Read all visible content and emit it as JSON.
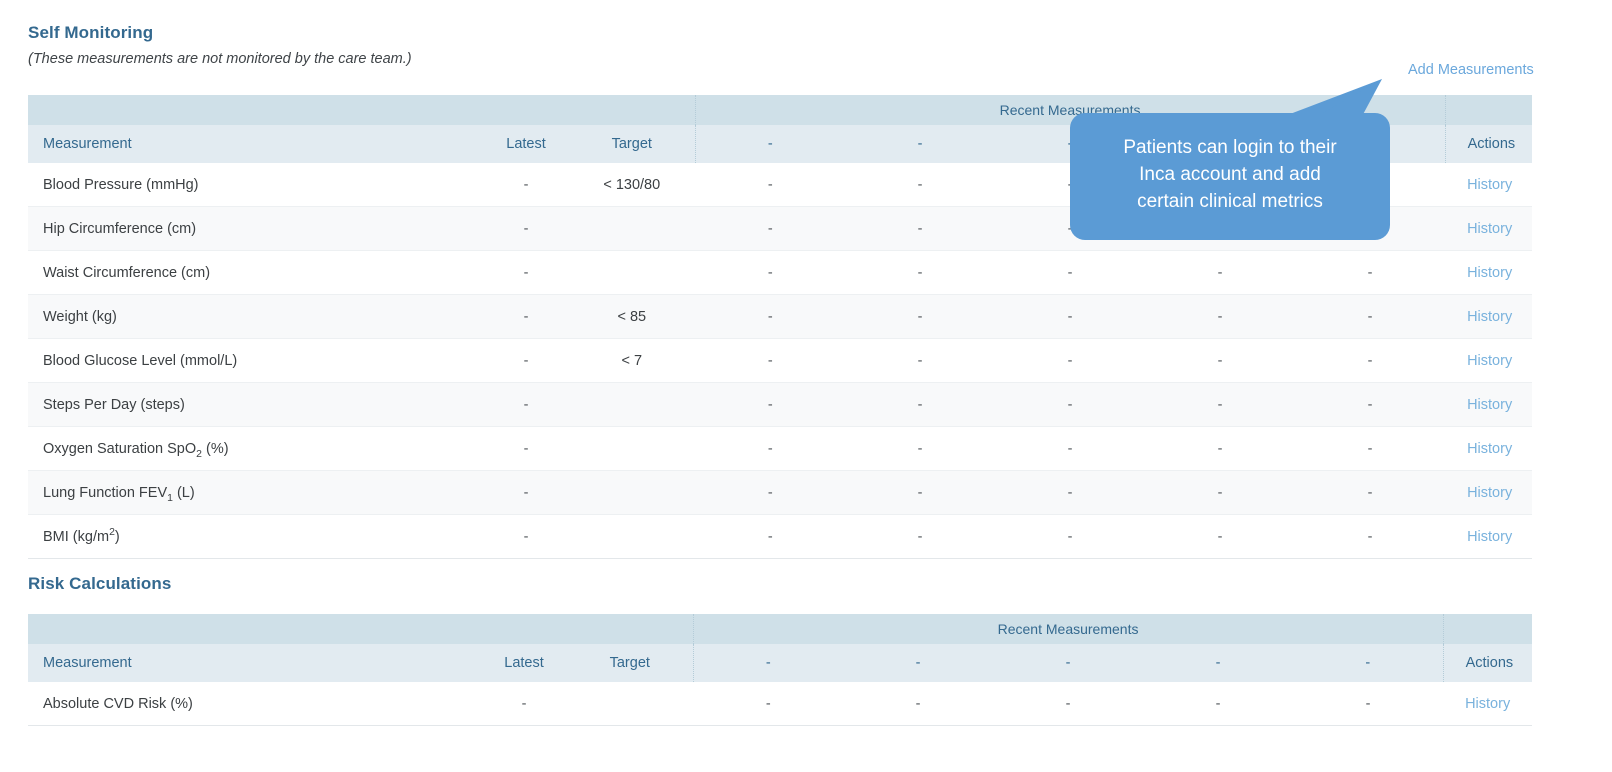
{
  "self_monitoring": {
    "title": "Self Monitoring",
    "subtitle": "(These measurements are not monitored by the care team.)",
    "add_link": "Add Measurements",
    "group_header": "Recent Measurements",
    "columns": {
      "measurement": "Measurement",
      "latest": "Latest",
      "target": "Target",
      "recent": [
        "-",
        "-",
        "-",
        "-",
        "-"
      ],
      "actions": "Actions"
    },
    "rows": [
      {
        "measurement": "Blood Pressure (mmHg)",
        "latest": "-",
        "target": "< 130/80",
        "recent": [
          "-",
          "-",
          "-",
          "-",
          "-"
        ],
        "action": "History"
      },
      {
        "measurement": "Hip Circumference (cm)",
        "latest": "-",
        "target": "",
        "recent": [
          "-",
          "-",
          "-",
          "-",
          "-"
        ],
        "action": "History"
      },
      {
        "measurement": "Waist Circumference (cm)",
        "latest": "-",
        "target": "",
        "recent": [
          "-",
          "-",
          "-",
          "-",
          "-"
        ],
        "action": "History"
      },
      {
        "measurement": "Weight (kg)",
        "latest": "-",
        "target": "< 85",
        "recent": [
          "-",
          "-",
          "-",
          "-",
          "-"
        ],
        "action": "History"
      },
      {
        "measurement": "Blood Glucose Level (mmol/L)",
        "latest": "-",
        "target": "< 7",
        "recent": [
          "-",
          "-",
          "-",
          "-",
          "-"
        ],
        "action": "History"
      },
      {
        "measurement": "Steps Per Day (steps)",
        "latest": "-",
        "target": "",
        "recent": [
          "-",
          "-",
          "-",
          "-",
          "-"
        ],
        "action": "History"
      },
      {
        "measurement_html": "Oxygen Saturation SpO<sub>2</sub> (%)",
        "measurement": "Oxygen Saturation SpO2 (%)",
        "latest": "-",
        "target": "",
        "recent": [
          "-",
          "-",
          "-",
          "-",
          "-"
        ],
        "action": "History"
      },
      {
        "measurement_html": "Lung Function FEV<sub>1</sub> (L)",
        "measurement": "Lung Function FEV1 (L)",
        "latest": "-",
        "target": "",
        "recent": [
          "-",
          "-",
          "-",
          "-",
          "-"
        ],
        "action": "History"
      },
      {
        "measurement_html": "BMI (kg/m<sup>2</sup>)",
        "measurement": "BMI (kg/m2)",
        "latest": "-",
        "target": "",
        "recent": [
          "-",
          "-",
          "-",
          "-",
          "-"
        ],
        "action": "History"
      }
    ]
  },
  "risk_calculations": {
    "title": "Risk Calculations",
    "group_header": "Recent Measurements",
    "columns": {
      "measurement": "Measurement",
      "latest": "Latest",
      "target": "Target",
      "recent": [
        "-",
        "-",
        "-",
        "-",
        "-"
      ],
      "actions": "Actions"
    },
    "rows": [
      {
        "measurement": "Absolute CVD Risk (%)",
        "latest": "-",
        "target": "",
        "recent": [
          "-",
          "-",
          "-",
          "-",
          "-"
        ],
        "action": "History"
      }
    ]
  },
  "callout": {
    "text": "Patients can login to their\nInca account and add\ncertain clinical metrics",
    "color": "#5b9bd5"
  },
  "colors": {
    "heading": "#34698f",
    "header_band_top": "#cfe0e8",
    "header_band_bottom": "#e2ebf1",
    "link": "#6ba8dc",
    "history_link": "#79b2dd",
    "row_alt": "#f8f9fa"
  }
}
